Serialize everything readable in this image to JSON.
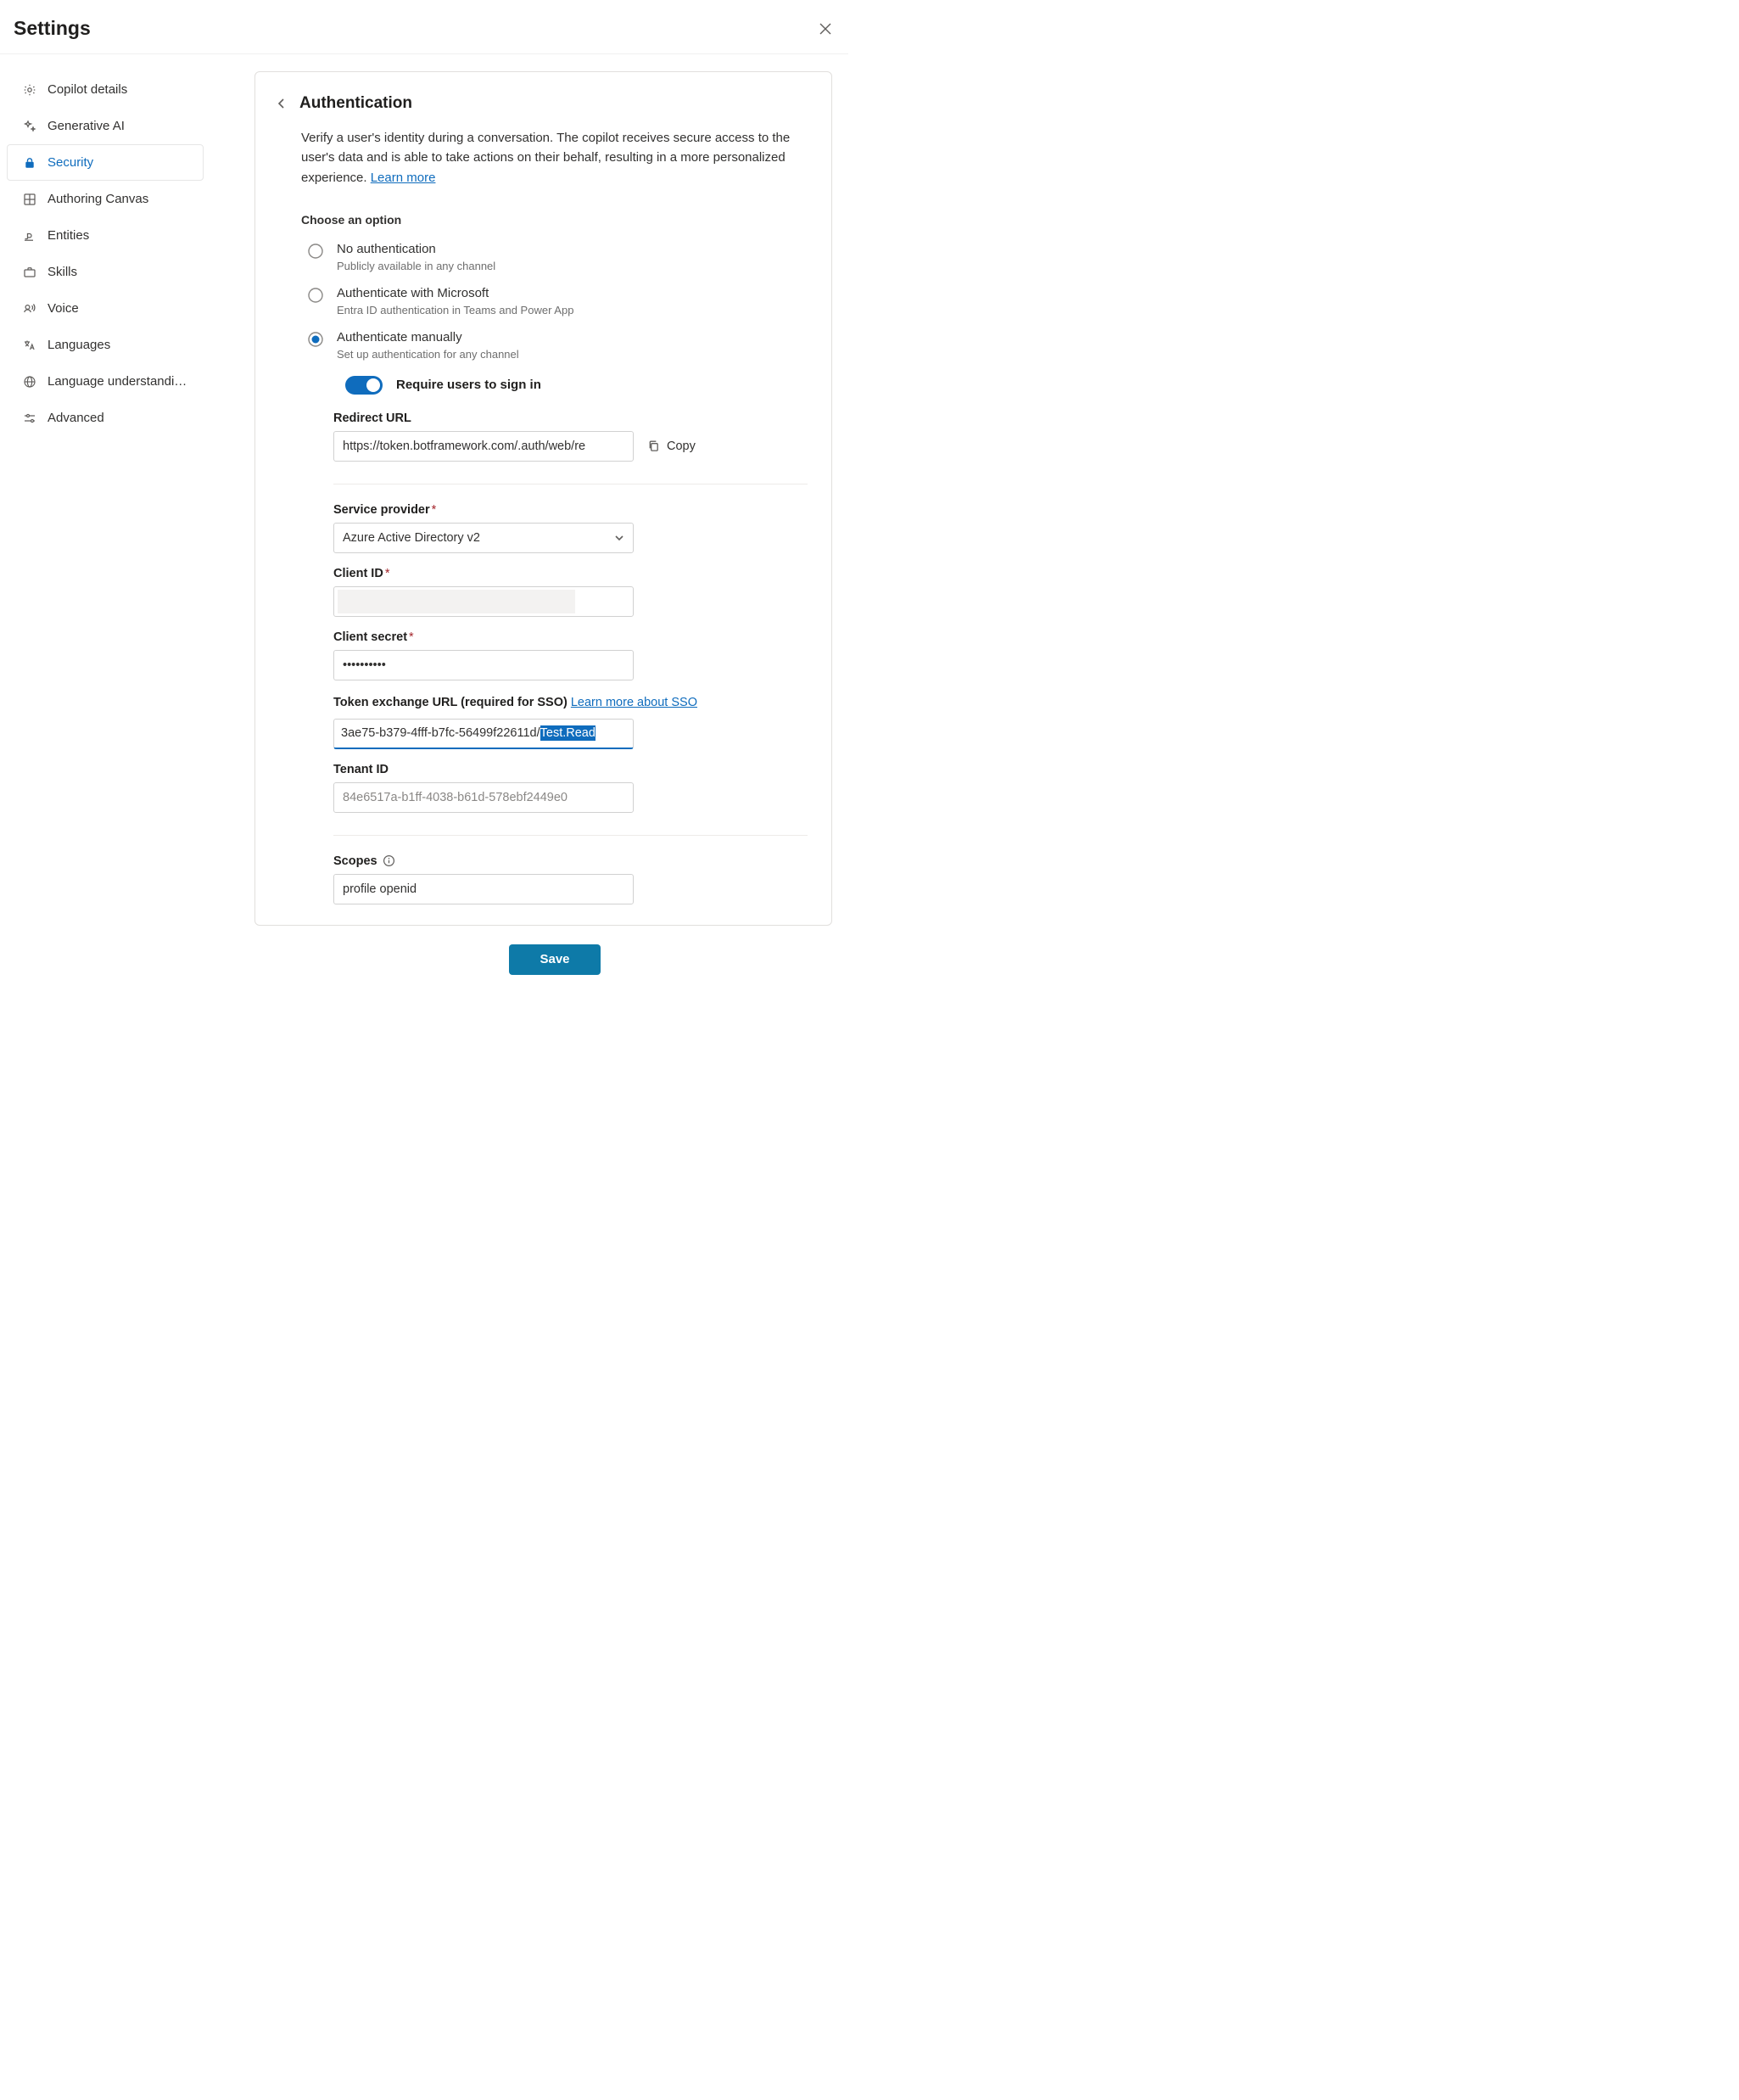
{
  "header": {
    "title": "Settings"
  },
  "sidebar": {
    "items": [
      {
        "id": "copilot-details",
        "label": "Copilot details"
      },
      {
        "id": "generative-ai",
        "label": "Generative AI"
      },
      {
        "id": "security",
        "label": "Security"
      },
      {
        "id": "authoring-canvas",
        "label": "Authoring Canvas"
      },
      {
        "id": "entities",
        "label": "Entities"
      },
      {
        "id": "skills",
        "label": "Skills"
      },
      {
        "id": "voice",
        "label": "Voice"
      },
      {
        "id": "languages",
        "label": "Languages"
      },
      {
        "id": "language-understanding",
        "label": "Language understandi…"
      },
      {
        "id": "advanced",
        "label": "Advanced"
      }
    ]
  },
  "panel": {
    "title": "Authentication",
    "description": "Verify a user's identity during a conversation. The copilot receives secure access to the user's data and is able to take actions on their behalf, resulting in a more personalized experience. ",
    "learn_more": "Learn more",
    "choose_label": "Choose an option",
    "options": {
      "none": {
        "title": "No authentication",
        "sub": "Publicly available in any channel"
      },
      "ms": {
        "title": "Authenticate with Microsoft",
        "sub": "Entra ID authentication in Teams and Power App"
      },
      "manual": {
        "title": "Authenticate manually",
        "sub": "Set up authentication for any channel"
      }
    },
    "require_signin_label": "Require users to sign in",
    "redirect": {
      "label": "Redirect URL",
      "value": "https://token.botframework.com/.auth/web/re",
      "copy": "Copy"
    },
    "service_provider": {
      "label": "Service provider",
      "value": "Azure Active Directory v2"
    },
    "client_id": {
      "label": "Client ID"
    },
    "client_secret": {
      "label": "Client secret",
      "value": "••••••••••"
    },
    "token_exchange": {
      "label_pre": "Token exchange URL (required for SSO) ",
      "link": "Learn more about SSO",
      "value_pre": "3ae75-b379-4fff-b7fc-56499f22611d/",
      "value_sel": "Test.Read"
    },
    "tenant_id": {
      "label": "Tenant ID",
      "placeholder": "84e6517a-b1ff-4038-b61d-578ebf2449e0"
    },
    "scopes": {
      "label": "Scopes",
      "value": "profile openid"
    }
  },
  "footer": {
    "save": "Save"
  }
}
